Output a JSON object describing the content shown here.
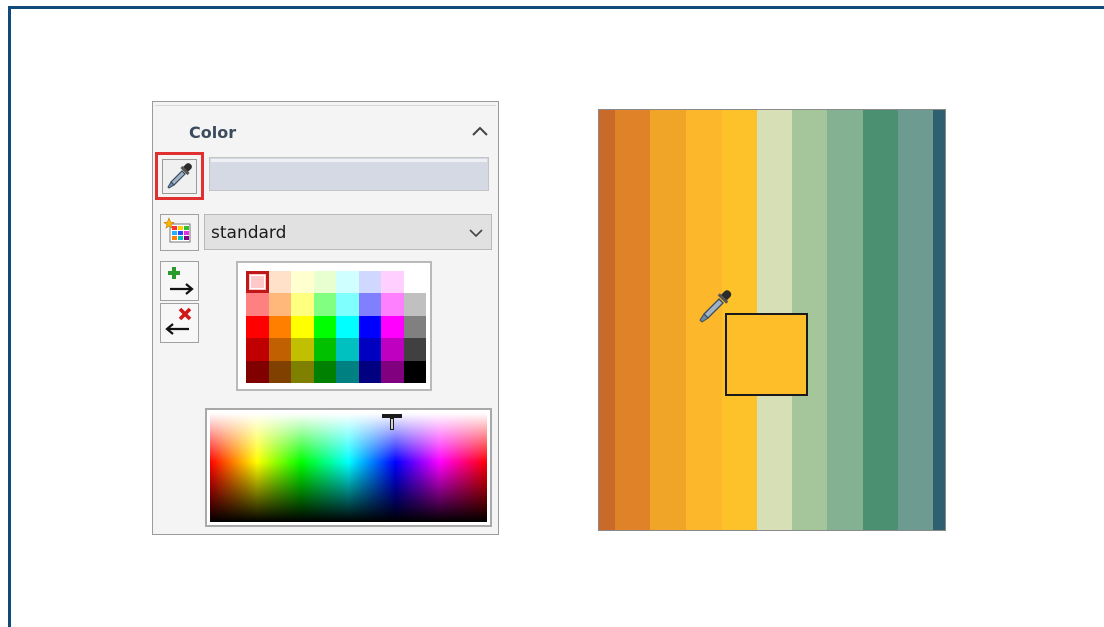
{
  "panel": {
    "title": "Color",
    "current_color_field": "",
    "palette_select": {
      "value": "standard"
    },
    "buttons": {
      "eyedropper": "eyedropper-icon",
      "palette_editor": "palette-icon",
      "add_color": "add-color-icon",
      "remove_color": "remove-color-icon",
      "collapse": "chevron-up-icon"
    },
    "selected_swatch": "#ffc9c9",
    "palette_rows": [
      [
        "#ffd0d0",
        "#ffe0c8",
        "#ffffd0",
        "#e8ffd0",
        "#d0ffff",
        "#d0d8ff",
        "#ffd0ff",
        "#ffffff"
      ],
      [
        "#ff8080",
        "#ffb87a",
        "#ffff80",
        "#80ff80",
        "#80ffff",
        "#8080ff",
        "#ff80ff",
        "#c0c0c0"
      ],
      [
        "#ff0000",
        "#ff8000",
        "#ffff00",
        "#00ff00",
        "#00ffff",
        "#0000ff",
        "#ff00ff",
        "#808080"
      ],
      [
        "#c00000",
        "#c06000",
        "#c0c000",
        "#00c000",
        "#00c0c0",
        "#0000c0",
        "#c000c0",
        "#404040"
      ],
      [
        "#800000",
        "#804000",
        "#808000",
        "#008000",
        "#008080",
        "#000080",
        "#800080",
        "#000000"
      ]
    ]
  },
  "preview": {
    "stripes": [
      "#c96a28",
      "#e08228",
      "#f0a428",
      "#fcb82a",
      "#fdc22a",
      "#d7dfb6",
      "#a4c69a",
      "#84b192",
      "#4b9070",
      "#6d9b92",
      "#2f6070"
    ],
    "picked_color": "#fdbe2a",
    "cursor": "eyedropper-icon"
  }
}
